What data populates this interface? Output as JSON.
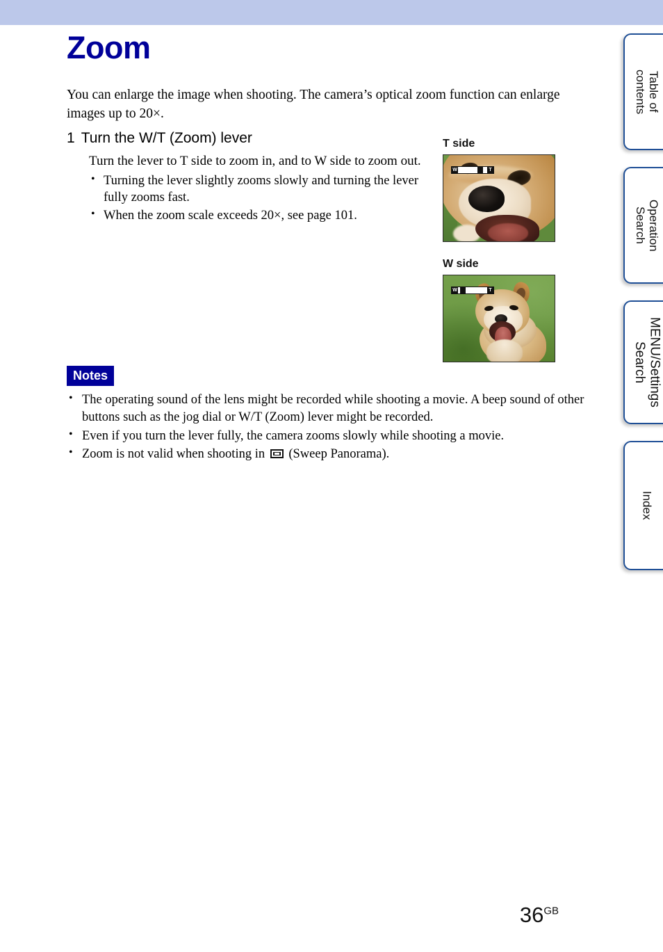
{
  "header": {
    "band_color": "#bcc8ea"
  },
  "title": "Zoom",
  "title_color": "#000099",
  "intro": "You can enlarge the image when shooting. The camera’s optical zoom function can enlarge images up to 20×.",
  "step": {
    "number": "1",
    "heading": "Turn the W/T (Zoom) lever",
    "lead": "Turn the lever to T side to zoom in, and to W side to zoom out.",
    "bullets": [
      "Turning the lever slightly zooms slowly and turning the lever fully zooms fast.",
      "When the zoom scale exceeds 20×, see page 101."
    ]
  },
  "samples": [
    {
      "label": "T side",
      "description": "Close-up photograph of a Shiba Inu dog's face, zoomed in to telephoto",
      "zoom_bar": {
        "left_cap": "W",
        "right_cap": "T",
        "position_percent": 82
      }
    },
    {
      "label": "W side",
      "description": "Wide photograph of a Shiba Inu dog sitting on green grass",
      "zoom_bar": {
        "left_cap": "W",
        "right_cap": "T",
        "position_percent": 8
      }
    }
  ],
  "notes": {
    "badge": "Notes",
    "badge_bg": "#000099",
    "badge_color": "#ffffff",
    "items": [
      "The operating sound of the lens might be recorded while shooting a movie. A beep sound of other buttons such as the jog dial or W/T (Zoom) lever might be recorded.",
      "Even if you turn the lever fully, the camera zooms slowly while shooting a movie.",
      "Zoom is not valid when shooting in "
    ],
    "panorama_note_suffix": " (Sweep Panorama)."
  },
  "page_number": {
    "number": "36",
    "suffix": "GB"
  },
  "tabs": [
    {
      "label": "Table of\ncontents"
    },
    {
      "label": "Operation\nSearch"
    },
    {
      "label": "MENU/Settings\nSearch"
    },
    {
      "label": "Index"
    }
  ],
  "tab_border_color": "#1f4f96"
}
